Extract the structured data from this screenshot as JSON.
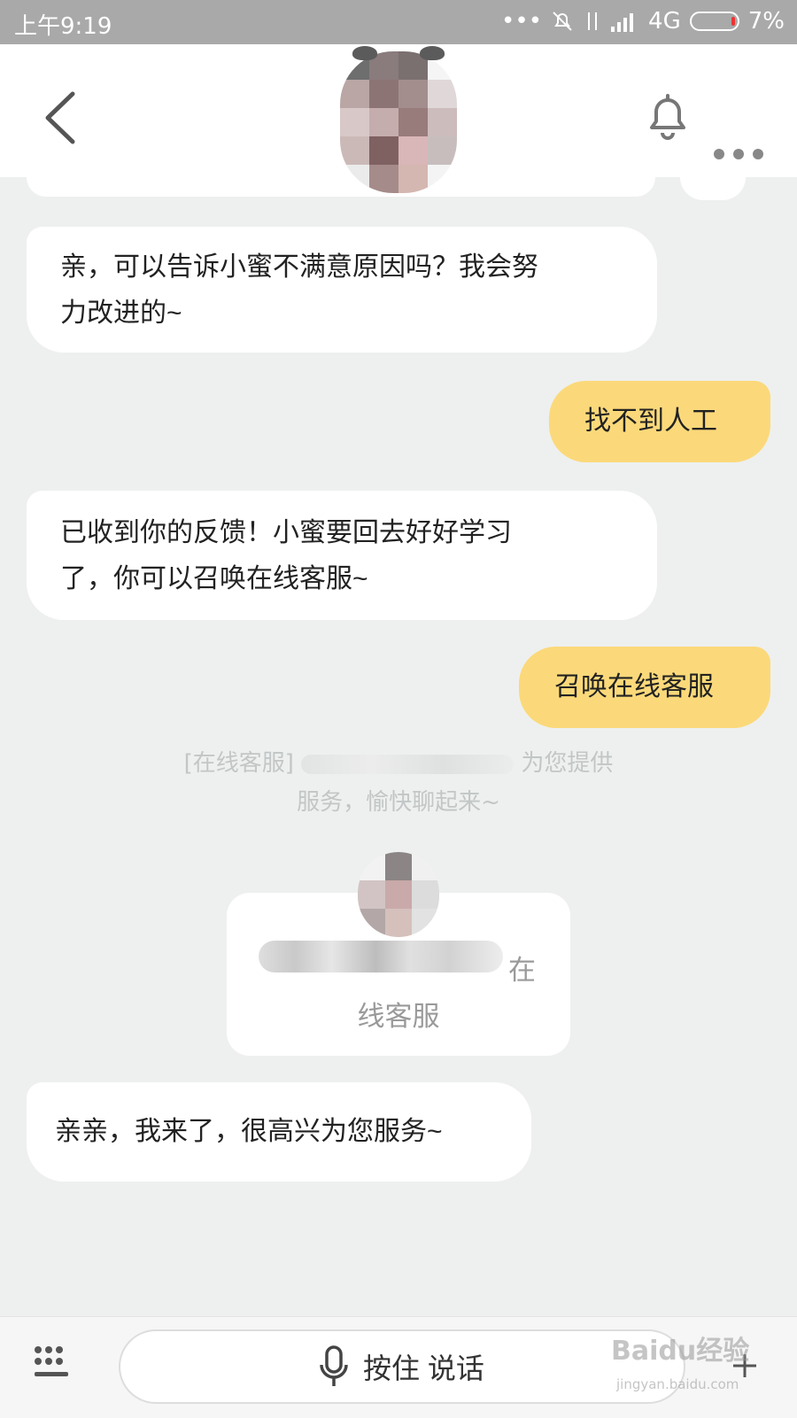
{
  "status_bar": {
    "time": "上午9:19",
    "network": "4G",
    "battery": "7%"
  },
  "messages": [
    {
      "side": "left",
      "text_lines": [
        "亲，可以告诉小蜜不满意原因吗？我会努",
        "力改进的~"
      ]
    },
    {
      "side": "right",
      "text": "找不到人工"
    },
    {
      "side": "left",
      "text_lines": [
        "已收到你的反馈！小蜜要回去好好学习",
        "了，你可以召唤在线客服~"
      ]
    },
    {
      "side": "right",
      "text": "召唤在线客服"
    }
  ],
  "system_notice": {
    "prefix": "[在线客服]",
    "suffix": "为您提供",
    "line2": "服务，愉快聊起来~"
  },
  "agent_card": {
    "suffix": "在",
    "line2": "线客服"
  },
  "last_message": "亲亲，我来了，很高兴为您服务~",
  "input_bar": {
    "voice_label": "按住 说话"
  },
  "watermark": {
    "main": "Baidu经验",
    "sub": "jingyan.baidu.com"
  },
  "colors": {
    "accent_bubble": "#fbd97a",
    "background": "#eef0ef",
    "status_bar": "#a9a9a9"
  }
}
